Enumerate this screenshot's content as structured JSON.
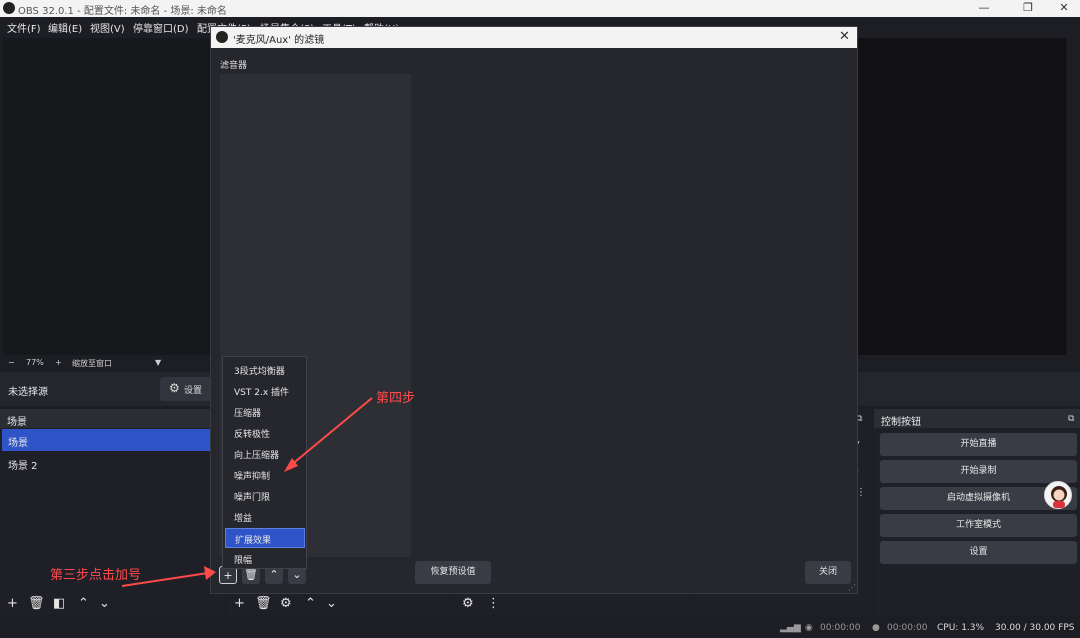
{
  "window": {
    "title": "OBS 32.0.1 - 配置文件: 未命名 - 场景: 未命名",
    "controls": [
      "minimize",
      "restore",
      "close"
    ]
  },
  "menubar": {
    "items": [
      "文件(F)",
      "编辑(E)",
      "视图(V)",
      "停靠窗口(D)",
      "配置文件(P)",
      "场景集合(S)",
      "工具(T)",
      "帮助(H)"
    ]
  },
  "zoombar": {
    "minus": "−",
    "zoom": "77%",
    "plus": "+",
    "fit": "缩放至窗口",
    "caret": "▼"
  },
  "sourcebar": {
    "no_selection": "未选择源",
    "settings": "设置"
  },
  "scenes": {
    "title": "场景",
    "items": [
      "场景",
      "场景 2"
    ]
  },
  "controls_dock": {
    "title": "控制按钮",
    "buttons": [
      "开始直播",
      "开始录制",
      "启动虚拟摄像机",
      "工作室模式",
      "设置"
    ]
  },
  "dialog": {
    "title": "'麦克风/Aux' 的滤镜",
    "filters_label": "滤音器",
    "reset_button": "恢复预设值",
    "close_button": "关闭"
  },
  "popup_menu": {
    "items": [
      "3段式均衡器",
      "VST 2.x 插件",
      "压缩器",
      "反转极性",
      "向上压缩器",
      "噪声抑制",
      "噪声门限",
      "增益",
      "扩展效果",
      "限幅"
    ],
    "highlighted": "扩展效果"
  },
  "annotations": {
    "step3": "第三步点击加号",
    "step4": "第四步",
    "color": "#ff4a4a"
  },
  "statusbar": {
    "stream_time": "00:00:00",
    "rec_time": "00:00:00",
    "cpu": "CPU: 1.3%",
    "fps": "30.00 / 30.00 FPS"
  },
  "colors": {
    "accent": "#2f54c7",
    "background": "#1d1e24",
    "panel": "#26272d"
  }
}
